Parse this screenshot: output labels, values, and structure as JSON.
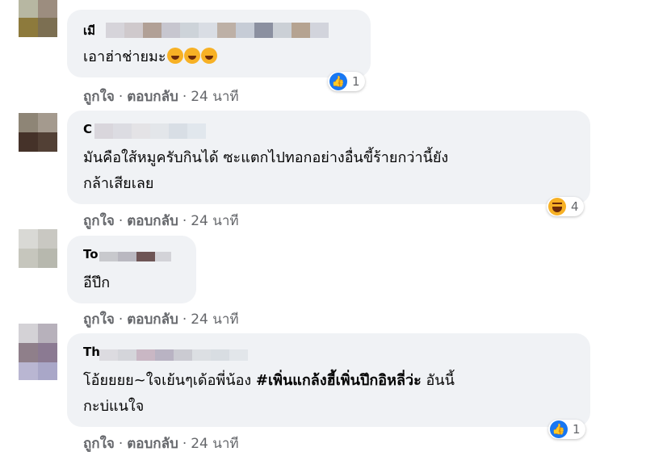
{
  "comments": [
    {
      "author": "เมี",
      "lines": [
        "เอาฮ่าช่ายมะ"
      ],
      "emoji": [
        "laughing-crying",
        "laughing-crying",
        "laughing-crying"
      ],
      "reaction": {
        "type": "like",
        "count": "1"
      },
      "actions": {
        "like": "ถูกใจ",
        "reply": "ตอบกลับ",
        "time": "24 นาที"
      }
    },
    {
      "author": "C",
      "lines": [
        "มันคือใส้หมูครับกินได้ ซะแตกไปทอกอย่างอื่นขี้ร้ายกว่านี้ยัง",
        "กล้าเสียเลย"
      ],
      "reaction": {
        "type": "haha",
        "count": "4"
      },
      "actions": {
        "like": "ถูกใจ",
        "reply": "ตอบกลับ",
        "time": "24 นาที"
      }
    },
    {
      "author": "To",
      "lines": [
        "อีปึก"
      ],
      "actions": {
        "like": "ถูกใจ",
        "reply": "ตอบกลับ",
        "time": "24 นาที"
      }
    },
    {
      "author": "Th",
      "line1_prefix": "โอ้ยยยย~ใจเย้นๆเด้อพี่น้อง ",
      "hashtag": "#เพิ่นแกล้งฮี้เพิ่นปึกอิหลี่ว่ะ",
      "line1_suffix": " อันนี้",
      "line2": "กะบ่แนใจ",
      "reaction": {
        "type": "like",
        "count": "1"
      },
      "actions": {
        "like": "ถูกใจ",
        "reply": "ตอบกลับ",
        "time": "24 นาที"
      }
    }
  ],
  "colors": {
    "bubble": "#f0f2f5",
    "link": "#65676b",
    "like": "#1877f2",
    "haha": "#f7b125"
  }
}
